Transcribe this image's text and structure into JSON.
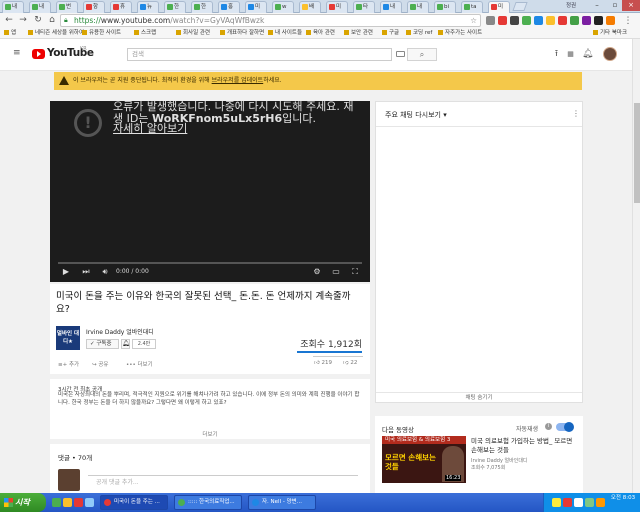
{
  "browser": {
    "tabs": [
      {
        "label": "내",
        "color": "#4caf50"
      },
      {
        "label": "내",
        "color": "#4caf50"
      },
      {
        "label": "번",
        "color": "#4caf50"
      },
      {
        "label": "항",
        "color": "#e53935"
      },
      {
        "label": "휴",
        "color": "#e53935"
      },
      {
        "label": "뉴",
        "color": "#1e88e5"
      },
      {
        "label": "한",
        "color": "#4caf50"
      },
      {
        "label": "한",
        "color": "#4caf50"
      },
      {
        "label": "홍",
        "color": "#1e88e5"
      },
      {
        "label": "미",
        "color": "#1e88e5"
      },
      {
        "label": "w",
        "color": "#4caf50"
      },
      {
        "label": "배",
        "color": "#fbc02d"
      },
      {
        "label": "미",
        "color": "#e53935"
      },
      {
        "label": "타",
        "color": "#4caf50"
      },
      {
        "label": "내",
        "color": "#1e88e5"
      },
      {
        "label": "내",
        "color": "#4caf50"
      },
      {
        "label": "bi",
        "color": "#4caf50"
      },
      {
        "label": "ta",
        "color": "#4caf50"
      },
      {
        "label": "미",
        "color": "#e53935"
      }
    ],
    "profile_label": "정권",
    "url_scheme": "https://",
    "url_host": "www.youtube.com",
    "url_path": "/watch?v=GyVAqWfBwzk",
    "bookmarks": [
      "앱",
      "네티즌 세상을 위하여",
      "유용한 사이트",
      "스크랩",
      "회사일 관련",
      "개표하다 잘하면",
      "내 사이트들",
      "육아 관련",
      "보안 관련",
      "구글",
      "코딩 ref",
      "자주가는 사이트",
      "기타 북마크"
    ]
  },
  "youtube": {
    "logo_text": "YouTube",
    "region": "KR",
    "search_placeholder": "검색",
    "warning_prefix": "이 브라우저는 곧 지원 중단됩니다. 최적의 환경을 위해 ",
    "warning_link": "브라우저를 업데이트",
    "warning_suffix": "하세요.",
    "player": {
      "error_line": "오류가 발생했습니다. 나중에 다시 시도해 주세요. 재생 ID는 ",
      "error_id": "WoRKFnom5uLx5rH6",
      "error_tail": "입니다.",
      "error_link": "자세히 알아보기",
      "time": "0:00 / 0:00"
    },
    "video": {
      "title": "미국이 돈을 주는 이유와 한국의 잘못된 선택_ 돈.돈. 돈 언제까지 계속줄까요?",
      "channel": "Irvine Daddy 얼바인대디",
      "channel_avatar_text": "얼바인 대디★",
      "subscribe": "구독중",
      "sub_count": "2.4만",
      "views": "조회수 1,912회",
      "add": "추가",
      "share": "공유",
      "more": "더보기",
      "likes": "219",
      "dislikes": "22"
    },
    "description": {
      "date": "3시간 전 최초 공개",
      "body": "미국은 사상최대의 돈을 뿌리며, 적극적인 지원으로 위기를 해쳐나가려 하고 있습니다. 이에 정부 돈의 의미와 계획 진행을 이야기 합니다. 한국 정부는 돈을 더 하지 않을까요? 그렇다면 왜 이렇게 하고 있죠?",
      "more": "더보기"
    },
    "comments": {
      "count": "댓글 • 70개",
      "placeholder": "공개 댓글 추가..."
    },
    "chat": {
      "title": "주요 채팅 다시보기",
      "hide": "채팅 숨기기"
    },
    "up_next": {
      "label": "다음 동영상",
      "autoplay": "자동재생",
      "thumb_top": "미국 의료보험 & 의료보험 3",
      "thumb_big": "모르면 손해보는 것들",
      "thumb_duration": "16:23",
      "title": "미국 의료보험 가입하는 방법_ 모르면 손해보는 것들",
      "channel": "Irvine Daddy 얼바인대디",
      "views": "조회수 7,075회"
    }
  },
  "taskbar": {
    "start": "시작",
    "tasks": [
      {
        "label": "미국이 돈을 주는 ...",
        "color": "#e53935"
      },
      {
        "label": "::::: 한국의료직업...",
        "color": "#4caf50"
      },
      {
        "label": "자. Nell - 양변...",
        "color": "#1e88e5"
      }
    ],
    "clock_time": "오전 8:03"
  }
}
